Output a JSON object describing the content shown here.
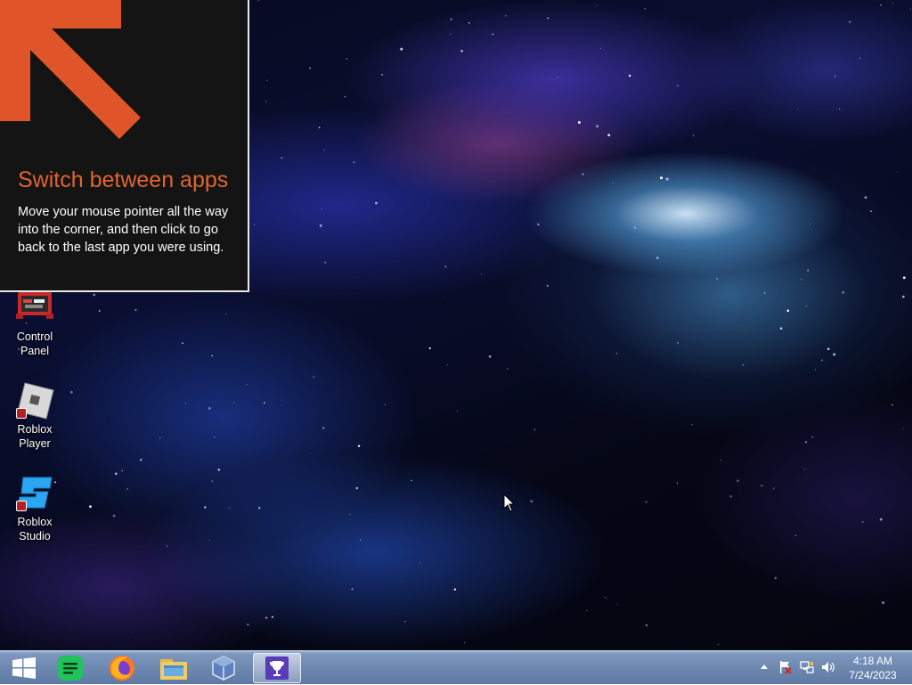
{
  "tip": {
    "title": "Switch between apps",
    "body": "Move your mouse pointer all the way into the corner, and then click to go back to the last app you were using."
  },
  "desktop_icons": [
    {
      "label": "Control Panel",
      "icon": "control-panel-icon"
    },
    {
      "label": "Roblox Player",
      "icon": "roblox-player-icon"
    },
    {
      "label": "Roblox Studio",
      "icon": "roblox-studio-icon"
    }
  ],
  "taskbar": {
    "apps": [
      {
        "name": "Start",
        "icon": "windows-start-icon"
      },
      {
        "name": "Spotify",
        "icon": "spotify-icon"
      },
      {
        "name": "Firefox",
        "icon": "firefox-icon"
      },
      {
        "name": "File Explorer",
        "icon": "file-explorer-icon"
      },
      {
        "name": "VirtualBox",
        "icon": "virtualbox-icon"
      },
      {
        "name": "Trophy app",
        "icon": "trophy-icon",
        "active": true
      }
    ],
    "tray": {
      "icons": [
        "show-hidden-icons-chevron",
        "action-center-flag-icon",
        "network-icon",
        "volume-icon"
      ],
      "time": "4:18 AM",
      "date": "7/24/2023"
    }
  },
  "colors": {
    "tip_accent": "#e0642e",
    "tip_background": "#141414",
    "taskbar": "#6e88b0"
  }
}
